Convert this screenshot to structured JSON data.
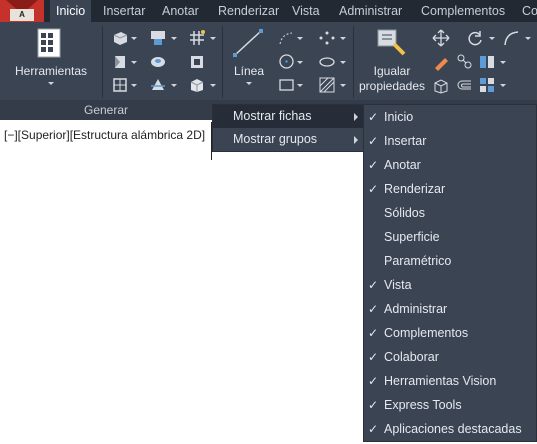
{
  "app": {
    "logo_letter": "A"
  },
  "tabs": [
    {
      "label": "Inicio",
      "active": true
    },
    {
      "label": "Insertar"
    },
    {
      "label": "Anotar"
    },
    {
      "label": "Renderizar"
    },
    {
      "label": "Vista"
    },
    {
      "label": "Administrar"
    },
    {
      "label": "Complementos"
    },
    {
      "label": "Co"
    }
  ],
  "ribbon": {
    "herramientas_label": "Herramientas",
    "linea_label": "Línea",
    "igualar_label_line1": "Igualar",
    "igualar_label_line2": "propiedades",
    "panel_generar": "Generar"
  },
  "viewport": {
    "label": "[−][Superior][Estructura alámbrica 2D]"
  },
  "context_menu": {
    "items": [
      {
        "label": "Mostrar fichas",
        "highlighted": true
      },
      {
        "label": "Mostrar grupos"
      }
    ]
  },
  "submenu": {
    "items": [
      {
        "label": "Inicio",
        "checked": true
      },
      {
        "label": "Insertar",
        "checked": true
      },
      {
        "label": "Anotar",
        "checked": true
      },
      {
        "label": "Renderizar",
        "checked": true
      },
      {
        "label": "Sólidos",
        "checked": false
      },
      {
        "label": "Superficie",
        "checked": false
      },
      {
        "label": "Paramétrico",
        "checked": false
      },
      {
        "label": "Vista",
        "checked": true
      },
      {
        "label": "Administrar",
        "checked": true
      },
      {
        "label": "Complementos",
        "checked": true
      },
      {
        "label": "Colaborar",
        "checked": true
      },
      {
        "label": "Herramientas Vision",
        "checked": true
      },
      {
        "label": "Express Tools",
        "checked": true
      },
      {
        "label": "Aplicaciones destacadas",
        "checked": true
      }
    ],
    "check_glyph": "✓"
  },
  "colors": {
    "tabbar_bg": "#222933",
    "ribbon_bg": "#3b4453",
    "menu_bg": "#3b4453",
    "menu_highlight": "#262d38",
    "app_button": "#c5312b"
  }
}
